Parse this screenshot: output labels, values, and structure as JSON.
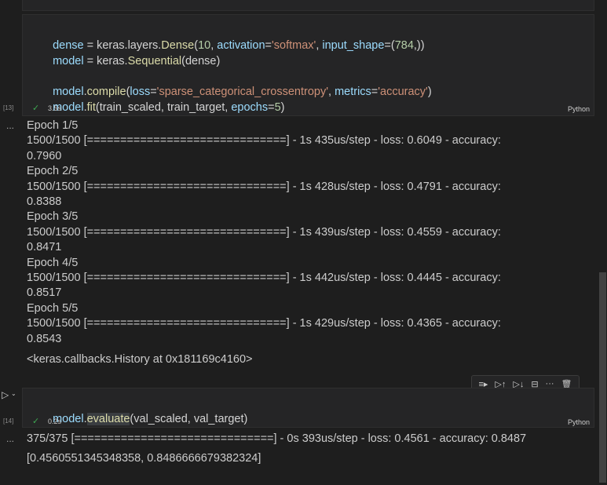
{
  "cells": [
    {
      "exec_count": "[13]",
      "code_lines": [
        "dense = keras.layers.Dense(10, activation='softmax', input_shape=(784,))",
        "model = keras.Sequential(dense)",
        "",
        "model.compile(loss='sparse_categorical_crossentropy', metrics='accuracy')",
        "model.fit(train_scaled, train_target, epochs=5)"
      ],
      "status": "✓",
      "time": "3.5s",
      "language": "Python",
      "output_prefix": "...",
      "output_lines": [
        "Epoch 1/5",
        "1500/1500 [==============================] - 1s 435us/step - loss: 0.6049 - accuracy:",
        "0.7960",
        "Epoch 2/5",
        "1500/1500 [==============================] - 1s 428us/step - loss: 0.4791 - accuracy:",
        "0.8388",
        "Epoch 3/5",
        "1500/1500 [==============================] - 1s 439us/step - loss: 0.4559 - accuracy:",
        "0.8471",
        "Epoch 4/5",
        "1500/1500 [==============================] - 1s 442us/step - loss: 0.4445 - accuracy:",
        "0.8517",
        "Epoch 5/5",
        "1500/1500 [==============================] - 1s 429us/step - loss: 0.4365 - accuracy:",
        "0.8543"
      ],
      "result": "<keras.callbacks.History at 0x181169c4160>"
    },
    {
      "exec_count": "[14]",
      "code_lines": [
        "model.evaluate(val_scaled, val_target)"
      ],
      "status": "✓",
      "time": "0.2s",
      "language": "Python",
      "output_prefix": "...",
      "output_lines": [
        "375/375 [==============================] - 0s 393us/step - loss: 0.4561 - accuracy: 0.8487",
        "[0.4560551345348358, 0.8486666679382324]"
      ]
    }
  ],
  "cell_toolbar": {
    "icons": [
      "run-by-line-icon",
      "execute-above-icon",
      "execute-below-icon",
      "split-cell-icon",
      "more-icon",
      "delete-icon"
    ]
  },
  "gutter": {
    "run_icon": "run-cell-icon",
    "run_chevron": "chevron-down-icon"
  },
  "colors": {
    "background": "#1e1e1e",
    "cell_background": "#252526",
    "string": "#ce9178",
    "number": "#b5cea8",
    "variable": "#9cdcfe",
    "success_check": "#3ea852"
  }
}
